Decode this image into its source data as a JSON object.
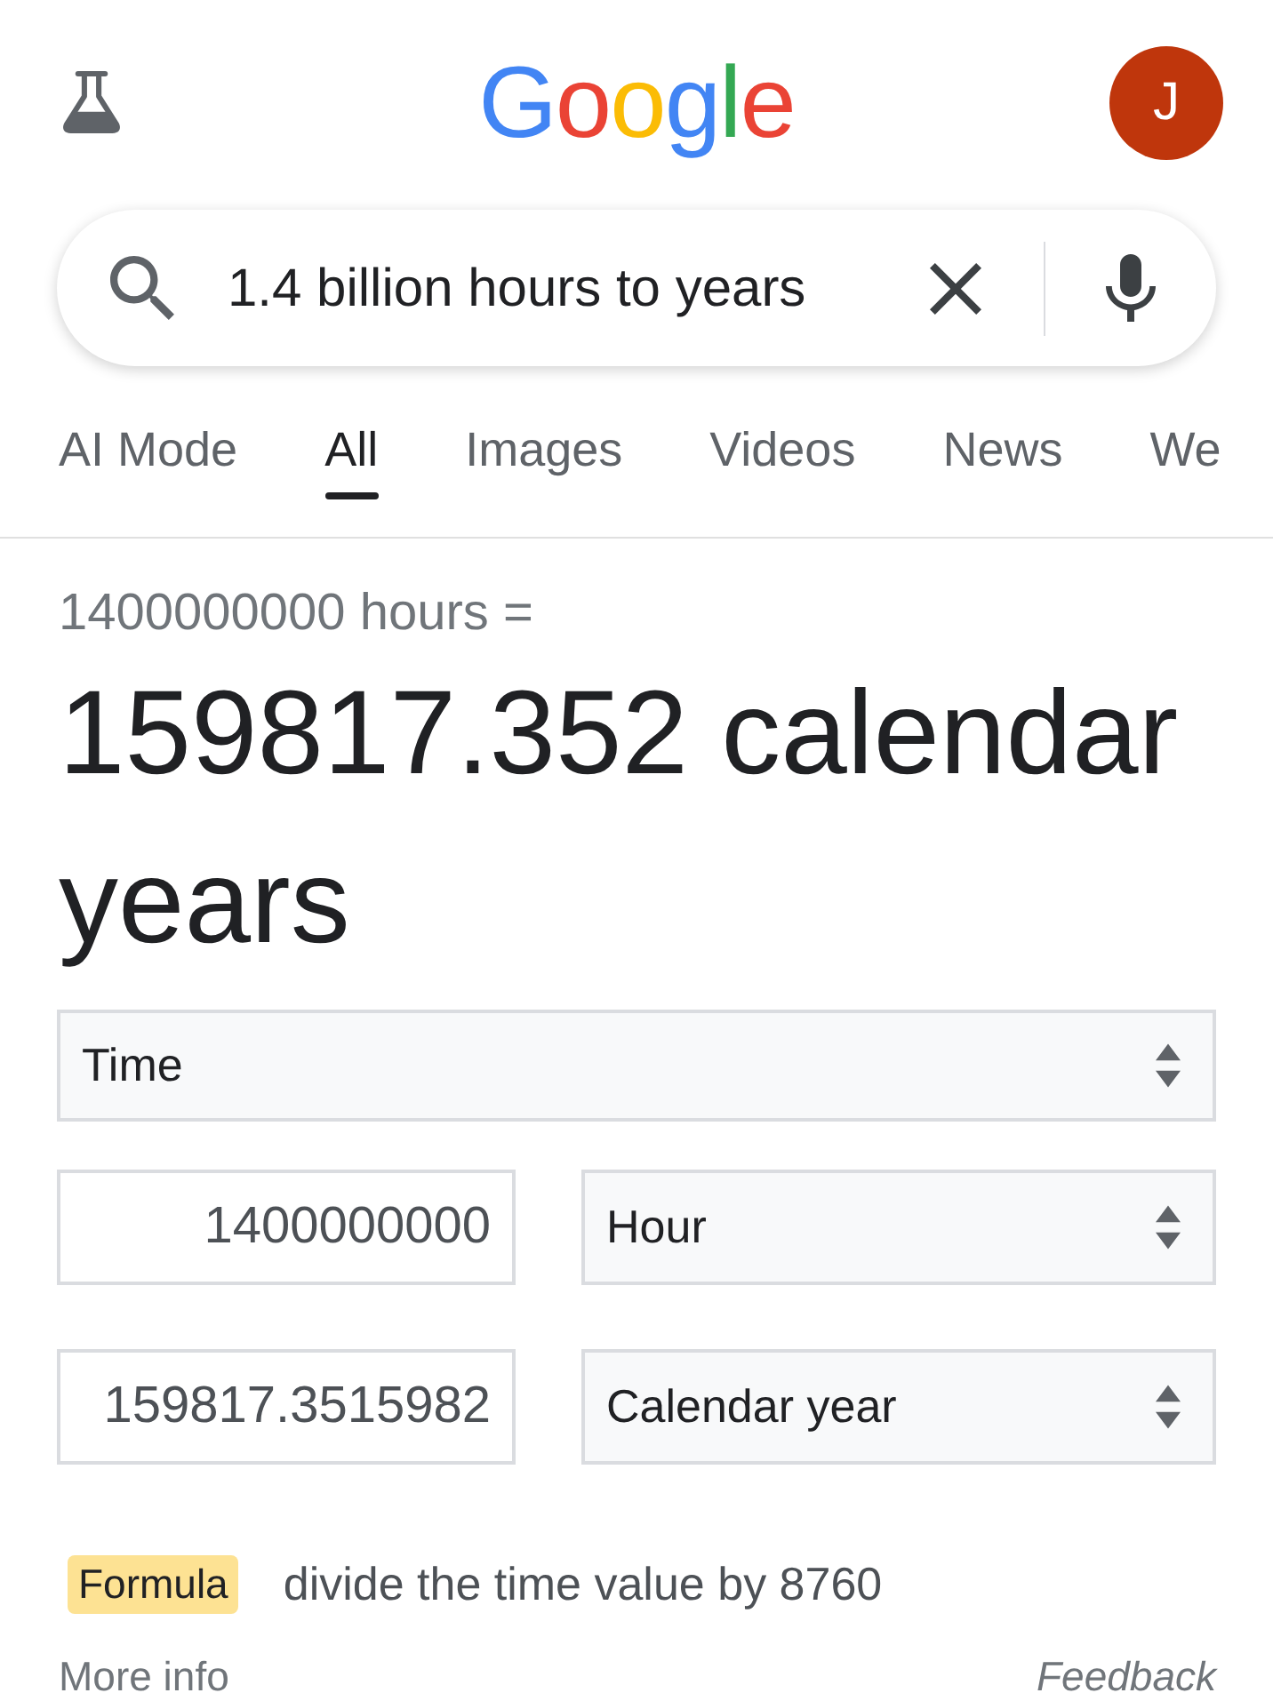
{
  "header": {
    "logo": "Google",
    "avatar": {
      "initial": "J"
    }
  },
  "search": {
    "query": "1.4 billion hours to years"
  },
  "tabs": [
    {
      "label": "AI Mode",
      "selected": false
    },
    {
      "label": "All",
      "selected": true
    },
    {
      "label": "Images",
      "selected": false
    },
    {
      "label": "Videos",
      "selected": false
    },
    {
      "label": "News",
      "selected": false
    },
    {
      "label": "We",
      "selected": false
    }
  ],
  "converter": {
    "equation": "1400000000 hours =",
    "result": "159817.352 calendar years",
    "quantity": "Time",
    "rows": [
      {
        "value": "1400000000",
        "unit": "Hour"
      },
      {
        "value": "159817.3515982",
        "unit": "Calendar year"
      }
    ],
    "formula": {
      "label": "Formula",
      "text": "divide the time value by 8760"
    },
    "more_info": "More info",
    "feedback": "Feedback"
  }
}
